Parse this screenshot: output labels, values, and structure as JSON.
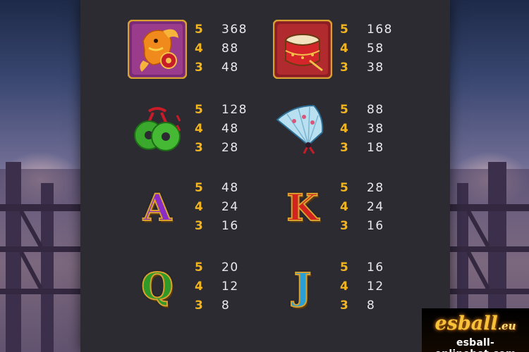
{
  "paytable": [
    {
      "symbol": "koi-fish",
      "icon": "koi-fish-icon",
      "payouts": [
        {
          "count": "5",
          "value": "368"
        },
        {
          "count": "4",
          "value": "88"
        },
        {
          "count": "3",
          "value": "48"
        }
      ]
    },
    {
      "symbol": "drum",
      "icon": "drum-icon",
      "payouts": [
        {
          "count": "5",
          "value": "168"
        },
        {
          "count": "4",
          "value": "58"
        },
        {
          "count": "3",
          "value": "38"
        }
      ]
    },
    {
      "symbol": "jade-coins",
      "icon": "jade-coins-icon",
      "payouts": [
        {
          "count": "5",
          "value": "128"
        },
        {
          "count": "4",
          "value": "48"
        },
        {
          "count": "3",
          "value": "28"
        }
      ]
    },
    {
      "symbol": "fan",
      "icon": "folding-fan-icon",
      "payouts": [
        {
          "count": "5",
          "value": "88"
        },
        {
          "count": "4",
          "value": "38"
        },
        {
          "count": "3",
          "value": "18"
        }
      ]
    },
    {
      "symbol": "A",
      "icon": "letter-a-icon",
      "letter": "A",
      "color": "#8a2cc6",
      "payouts": [
        {
          "count": "5",
          "value": "48"
        },
        {
          "count": "4",
          "value": "24"
        },
        {
          "count": "3",
          "value": "16"
        }
      ]
    },
    {
      "symbol": "K",
      "icon": "letter-k-icon",
      "letter": "K",
      "color": "#d2231f",
      "payouts": [
        {
          "count": "5",
          "value": "28"
        },
        {
          "count": "4",
          "value": "24"
        },
        {
          "count": "3",
          "value": "16"
        }
      ]
    },
    {
      "symbol": "Q",
      "icon": "letter-q-icon",
      "letter": "Q",
      "color": "#2f9a27",
      "payouts": [
        {
          "count": "5",
          "value": "20"
        },
        {
          "count": "4",
          "value": "12"
        },
        {
          "count": "3",
          "value": "8"
        }
      ]
    },
    {
      "symbol": "J",
      "icon": "letter-j-icon",
      "letter": "J",
      "color": "#2a9fd4",
      "payouts": [
        {
          "count": "5",
          "value": "16"
        },
        {
          "count": "4",
          "value": "12"
        },
        {
          "count": "3",
          "value": "8"
        }
      ]
    }
  ],
  "watermark": {
    "brand": "esball",
    "suffix": ".eu",
    "site": "esball-onlinebet.com"
  },
  "colors": {
    "count": "#f3b51f",
    "value": "#e9e9ec",
    "panel": "#2b2b31"
  }
}
